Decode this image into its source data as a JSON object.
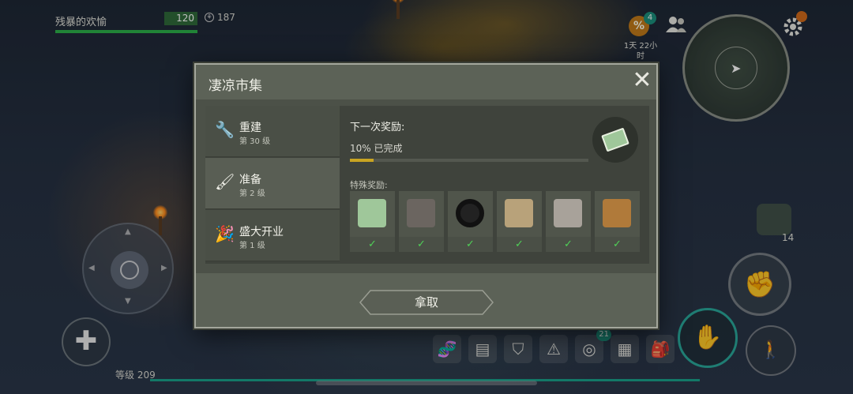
{
  "hud": {
    "player_name": "残暴的欢愉",
    "hp": "120",
    "coins": "187",
    "event_badge": "4",
    "event_timer": "1天 22小时",
    "backpack_count": "14",
    "level_label": "等级 209",
    "toolbar_badge": "21"
  },
  "modal": {
    "title": "凄凉市集",
    "sidebar": [
      {
        "label": "重建",
        "sub": "第 30 级",
        "icon": "wrench-icon"
      },
      {
        "label": "准备",
        "sub": "第 2 级",
        "icon": "brush-icon"
      },
      {
        "label": "盛大开业",
        "sub": "第 1 级",
        "icon": "party-popper-icon"
      }
    ],
    "next_reward_label": "下一次奖励:",
    "progress_text": "10% 已完成",
    "progress": 0.1,
    "special_label": "特殊奖励:",
    "rewards": [
      {
        "name": "ticket",
        "color": "#9fc79a"
      },
      {
        "name": "gun",
        "color": "#6b6560"
      },
      {
        "name": "vinyl-record",
        "color": "#222222"
      },
      {
        "name": "scroll-bundle",
        "color": "#b8a27a"
      },
      {
        "name": "engine-part",
        "color": "#a8a29a"
      },
      {
        "name": "crate-bundle",
        "color": "#b07a3a"
      }
    ],
    "check_mark": "✓",
    "claim_label": "拿取",
    "close_glyph": "✕"
  },
  "colors": {
    "accent_teal": "#1b8f7c",
    "progress_gold": "#c9a422",
    "check_green": "#4fd057"
  }
}
